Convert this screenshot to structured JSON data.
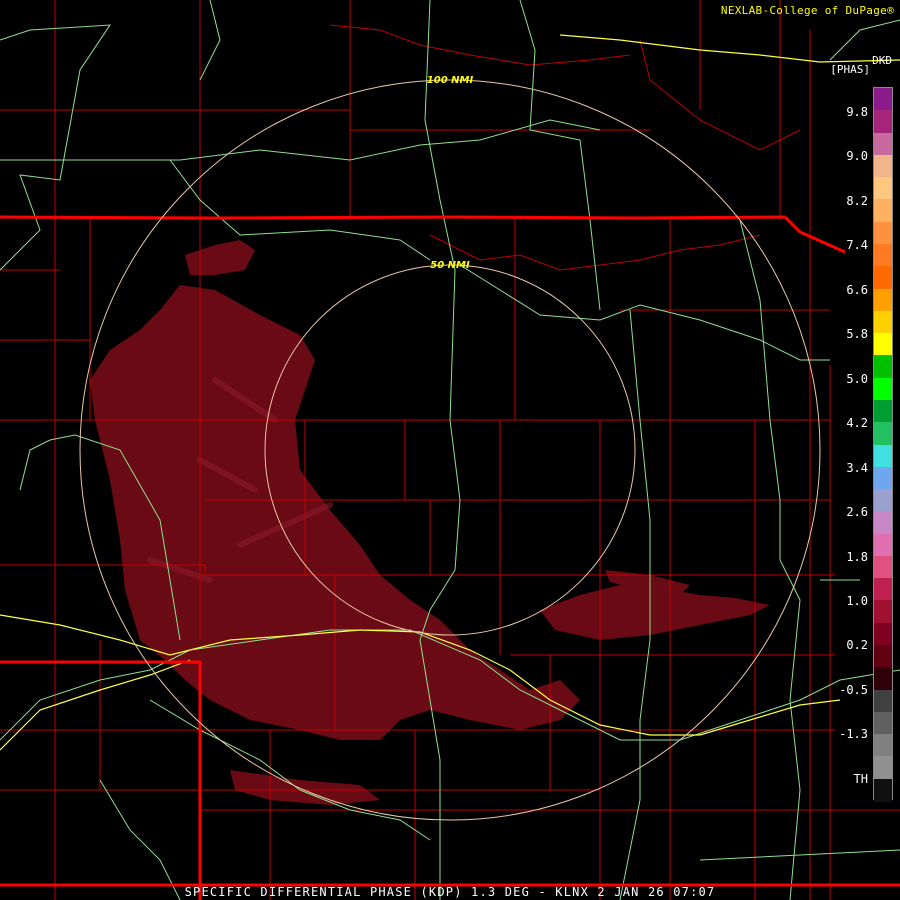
{
  "header": {
    "credit": "NEXLAB-College of DuPage",
    "credit_suffix": "®",
    "product_code": "DKD",
    "units": "[PHAS]"
  },
  "range_rings": [
    {
      "label": "50 NMI"
    },
    {
      "label": "100 NMI"
    }
  ],
  "legend": {
    "labels": [
      "9.8",
      "9.0",
      "8.2",
      "7.4",
      "6.6",
      "5.8",
      "5.0",
      "4.2",
      "3.4",
      "2.6",
      "1.8",
      "1.0",
      "0.2",
      "-0.5",
      "-1.3",
      "TH"
    ],
    "colors": [
      "#8b1a8b",
      "#a4257a",
      "#c86aa0",
      "#f0b58a",
      "#ffc680",
      "#ffb060",
      "#ff9040",
      "#ff7a20",
      "#ff6a00",
      "#ffa000",
      "#ffd000",
      "#ffff00",
      "#00c000",
      "#00ff00",
      "#009e30",
      "#22c060",
      "#40e0e0",
      "#6fa7ef",
      "#9aa0d0",
      "#c888c8",
      "#e070b0",
      "#e05080",
      "#c02050",
      "#a01030",
      "#800020",
      "#600010",
      "#300008",
      "#404040",
      "#606060",
      "#808080",
      "#909090",
      "#101010"
    ]
  },
  "colors": {
    "state_border": "#ff0000",
    "county_border": "#c00000",
    "highway": "#8fe08f",
    "interstate": "#ffff40",
    "range_ring": "#e8c8a8",
    "echo_fill": "#6a0a14",
    "ring_label": "#ffff00"
  },
  "footer": {
    "text": "SPECIFIC DIFFERENTIAL PHASE (KDP) 1.3 DEG - KLNX 2 JAN 26 07:07"
  }
}
